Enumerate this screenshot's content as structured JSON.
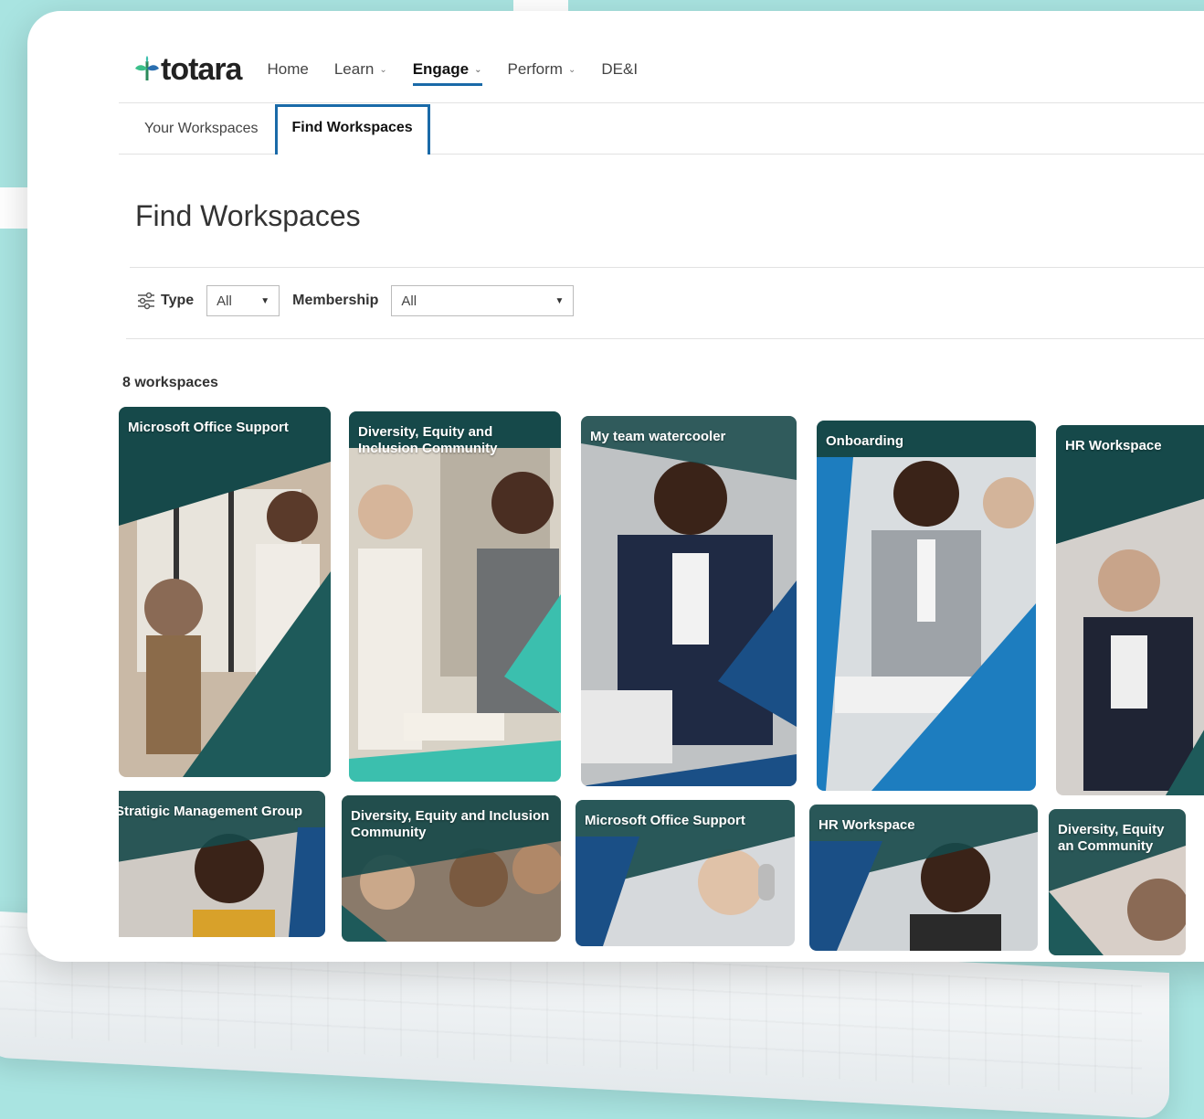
{
  "brand": {
    "logo_text": "totara",
    "accent": "#1a6aa8",
    "teal": "#1e5a5a",
    "mint": "#3bbfae",
    "background": "#a9e4e1"
  },
  "nav": {
    "items": [
      {
        "label": "Home",
        "dropdown": false,
        "active": false
      },
      {
        "label": "Learn",
        "dropdown": true,
        "active": false
      },
      {
        "label": "Engage",
        "dropdown": true,
        "active": true
      },
      {
        "label": "Perform",
        "dropdown": true,
        "active": false
      },
      {
        "label": "DE&I",
        "dropdown": false,
        "active": false
      }
    ]
  },
  "subnav": {
    "tabs": [
      {
        "label": "Your Workspaces",
        "active": false
      },
      {
        "label": "Find Workspaces",
        "active": true
      }
    ]
  },
  "page": {
    "title": "Find Workspaces",
    "count": "8 workspaces"
  },
  "filters": {
    "type_label": "Type",
    "type_value": "All",
    "membership_label": "Membership",
    "membership_value": "All",
    "icon": "sliders-icon"
  },
  "cards_row1": [
    {
      "title": "Microsoft  Office Support",
      "theme": "#1e5a5a"
    },
    {
      "title": "Diversity, Equity and Inclusion Community",
      "theme": "#3bbfae"
    },
    {
      "title": "My team watercooler",
      "theme": "#1a4f86"
    },
    {
      "title": "Onboarding",
      "theme": "#1d7dbf"
    },
    {
      "title": "HR Workspace",
      "theme": "#1e5a5a"
    }
  ],
  "cards_row2": [
    {
      "title": "Stratigic Management Group",
      "theme": "#1a4f86"
    },
    {
      "title": "Diversity, Equity and Inclusion Community",
      "theme": "#1e5a5a"
    },
    {
      "title": "Microsoft Office Support",
      "theme": "#1a4f86"
    },
    {
      "title": "HR Workspace",
      "theme": "#1a4f86"
    },
    {
      "title": "Diversity, Equity an Community",
      "theme": "#1e5a5a"
    }
  ]
}
